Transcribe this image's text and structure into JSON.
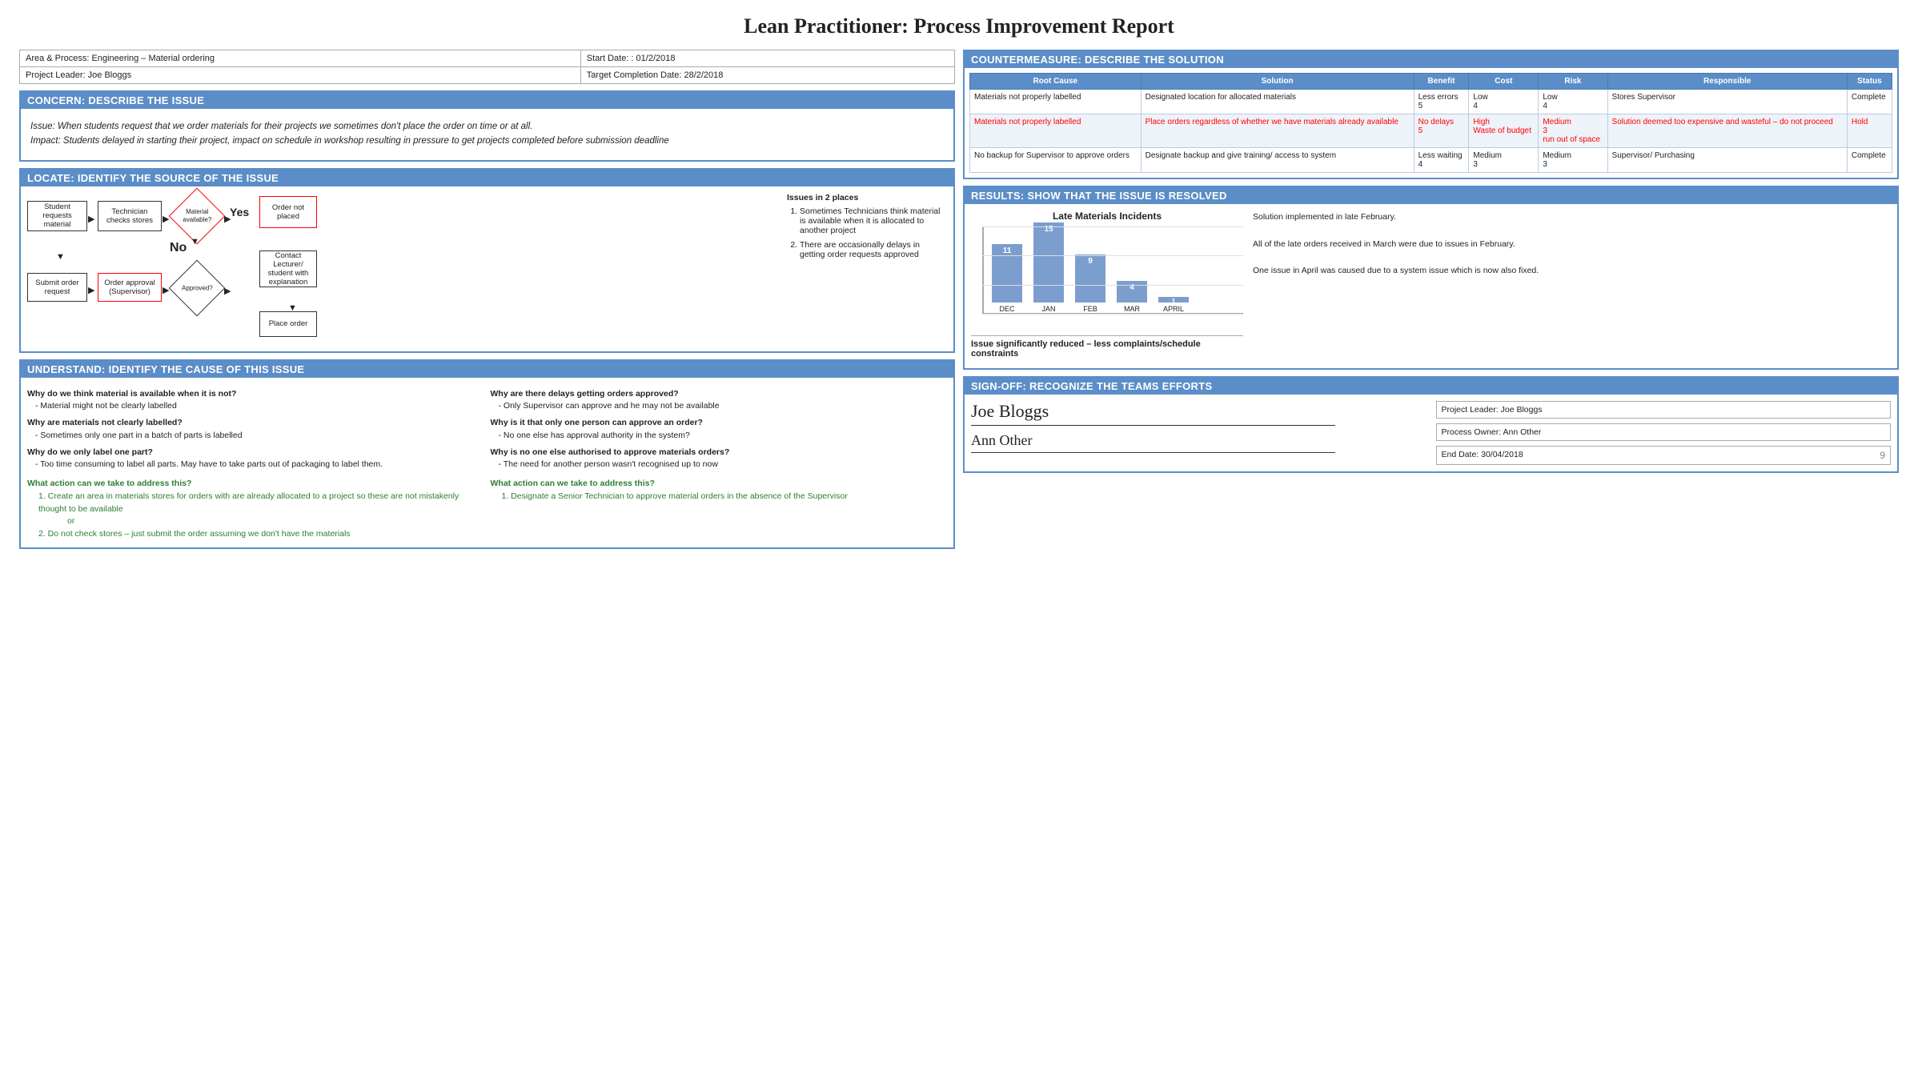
{
  "title": "Lean Practitioner: Process Improvement Report",
  "header": {
    "area_label": "Area & Process: Engineering – Material ordering",
    "start_date_label": "Start Date: : 01/2/2018",
    "project_leader_label": "Project Leader: Joe Bloggs",
    "target_completion_label": "Target Completion Date: 28/2/2018"
  },
  "concern": {
    "section_title": "CONCERN: DESCRIBE THE ISSUE",
    "text": "Issue: When students request that we order materials for their projects we sometimes don't place the order on time or at all.\nImpact:  Students delayed in starting their project, impact on schedule in workshop resulting in pressure to get projects completed before submission deadline"
  },
  "locate": {
    "section_title": "LOCATE: IDENTIFY THE SOURCE OF THE ISSUE",
    "issues_title": "Issues in 2 places",
    "issues": [
      "Sometimes Technicians think material is available when it is allocated to another project",
      "There are occasionally delays in getting order requests approved"
    ],
    "flow_nodes": {
      "student_requests": "Student requests material",
      "technician_checks": "Technician checks stores",
      "material_available": "Material available?",
      "order_not_placed": "Order not placed",
      "yes_label": "Yes",
      "no_label": "No",
      "contact_lecturer": "Contact Lecturer/ student with explanation",
      "submit_order": "Submit order request",
      "order_approval": "Order approval (Supervisor)",
      "approved": "Approved?",
      "place_order": "Place order"
    }
  },
  "understand": {
    "section_title": "UNDERSTAND: IDENTIFY THE CAUSE OF THIS ISSUE",
    "left_qa": [
      {
        "q": "Why do we think material is available when it is not?",
        "a": "- Material might not be clearly labelled"
      },
      {
        "q": "Why are materials not clearly labelled?",
        "a": "- Sometimes only one part in a batch of parts is labelled"
      },
      {
        "q": "Why do we only label one part?",
        "a": "- Too time consuming to label all parts. May have to take parts out of packaging to label them."
      }
    ],
    "left_action_heading": "What action can we take to address this?",
    "left_actions": [
      "Create an area in materials stores for orders with are already allocated to a project so these are not mistakenly thought to be available",
      "or",
      "Do not check stores – just submit the order assuming we don't have the materials"
    ],
    "right_qa": [
      {
        "q": "Why are there delays getting orders approved?",
        "a": "- Only Supervisor can approve and he may not be available"
      },
      {
        "q": "Why is it that only one person can approve an order?",
        "a": "- No one else has approval authority in the system?"
      },
      {
        "q": "Why is no one else authorised to approve materials orders?",
        "a": "- The need for another person wasn't recognised up to now"
      }
    ],
    "right_action_heading": "What action can we take to address this?",
    "right_actions": [
      "Designate a Senior Technician to approve material orders in the absence of the Supervisor"
    ]
  },
  "countermeasure": {
    "section_title": "COUNTERMEASURE: DESCRIBE THE SOLUTION",
    "headers": [
      "Root Cause",
      "Solution",
      "Benefit",
      "Cost",
      "Risk",
      "Responsible",
      "Status"
    ],
    "rows": [
      {
        "root_cause": "Materials not properly labelled",
        "solution": "Designated location for allocated materials",
        "benefit": "Less errors\n5",
        "cost": "Low\n4",
        "risk": "Low\n4",
        "responsible": "Stores Supervisor",
        "status": "Complete",
        "highlight": false
      },
      {
        "root_cause": "Materials not properly labelled",
        "solution": "Place orders regardless of whether we have materials already available",
        "benefit": "No delays\n5",
        "cost": "High\nWaste of budget",
        "risk": "Medium\n3\nrun out of space",
        "responsible": "Solution deemed too expensive and wasteful – do not proceed",
        "status": "Hold",
        "highlight": true
      },
      {
        "root_cause": "No backup for Supervisor to approve orders",
        "solution": "Designate backup and give training/ access to system",
        "benefit": "Less waiting\n4",
        "cost": "Medium\n3",
        "risk": "Medium\n3",
        "responsible": "Supervisor/ Purchasing",
        "status": "Complete",
        "highlight": false
      }
    ]
  },
  "results": {
    "section_title": "RESULTS: SHOW THAT THE ISSUE IS RESOLVED",
    "chart_title": "Late Materials Incidents",
    "bars": [
      {
        "label": "DEC",
        "value": 11,
        "height_pct": 73
      },
      {
        "label": "JAN",
        "value": 15,
        "height_pct": 100
      },
      {
        "label": "FEB",
        "value": 9,
        "height_pct": 60
      },
      {
        "label": "MAR",
        "value": 4,
        "height_pct": 27
      },
      {
        "label": "APRIL",
        "value": 1,
        "height_pct": 7
      }
    ],
    "text": "Solution implemented in late February.\nAll of the late orders received in March were due to issues in February.\nOne issue in April was caused due to a system issue which is now also fixed.",
    "summary": "Issue significantly reduced – less complaints/schedule constraints"
  },
  "signoff": {
    "section_title": "SIGN-OFF: RECOGNIZE THE TEAMS EFFORTS",
    "sig1_name": "Joe Bloggs",
    "sig2_name": "Ann Other",
    "project_leader_field": "Project Leader: Joe Bloggs",
    "process_owner_field": "Process Owner: Ann Other",
    "end_date_field": "End Date: 30/04/2018",
    "end_date_num": "9"
  }
}
